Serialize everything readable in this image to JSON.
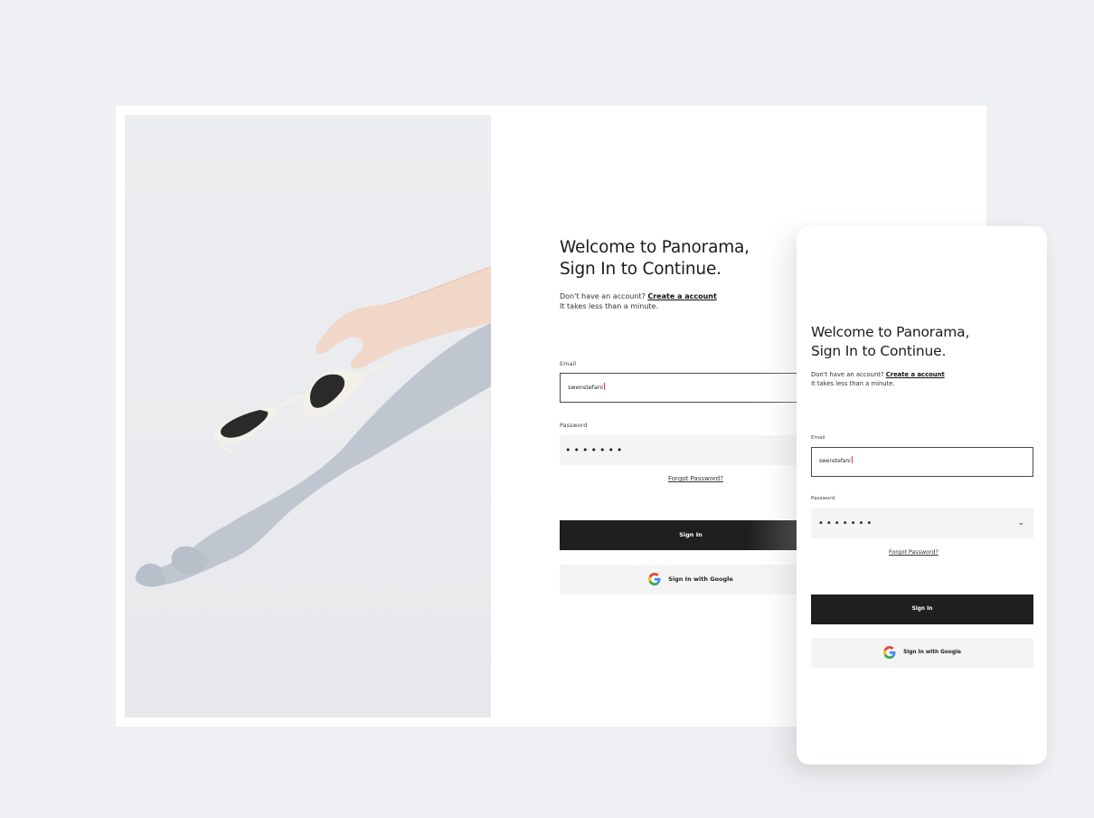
{
  "desktop": {
    "title_line1": "Welcome to Panorama,",
    "title_line2": "Sign In to Continue.",
    "no_account_text": "Don't have an account?",
    "create_account_link": "Create a account",
    "takes_less": "It takes less than a minute.",
    "email_label": "Email",
    "email_value": "swenstefani",
    "password_label": "Password",
    "password_mask": "•••••••",
    "forgot_password": "Forgot Password?",
    "sign_in_button": "Sign In",
    "google_button": "Sign In with Google"
  },
  "mobile": {
    "title_line1": "Welcome to Panorama,",
    "title_line2": "Sign In to Continue.",
    "no_account_text": "Don't have an account?",
    "create_account_link": "Create a account",
    "takes_less": "It takes less than a minute.",
    "email_label": "Email",
    "email_value": "swenstefani",
    "password_label": "Password",
    "password_mask": "•••••••",
    "forgot_password": "Forgot Password?",
    "sign_in_button": "Sign In",
    "google_button": "Sign In with Google",
    "toggle_icon": "chevron-down-icon"
  },
  "colors": {
    "background": "#eef0f3",
    "button_dark": "#1f1f1f",
    "field_fill": "#f4f4f5",
    "caret": "#e33333",
    "google_blue": "#4285F4",
    "google_red": "#EA4335",
    "google_yellow": "#FBBC05",
    "google_green": "#34A853"
  }
}
